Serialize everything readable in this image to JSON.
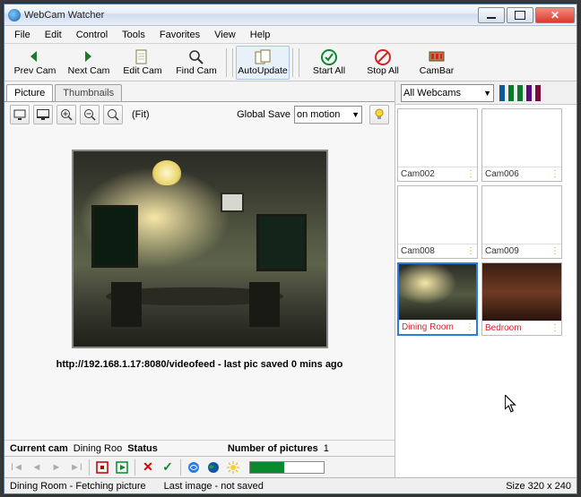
{
  "window": {
    "title": "WebCam Watcher"
  },
  "menubar": [
    "File",
    "Edit",
    "Control",
    "Tools",
    "Favorites",
    "View",
    "Help"
  ],
  "toolbar": [
    {
      "name": "prev-cam-button",
      "label": "Prev Cam",
      "icon": "arrow-left"
    },
    {
      "name": "next-cam-button",
      "label": "Next Cam",
      "icon": "arrow-right"
    },
    {
      "name": "edit-cam-button",
      "label": "Edit Cam",
      "icon": "doc"
    },
    {
      "name": "find-cam-button",
      "label": "Find Cam",
      "icon": "magnifier"
    },
    {
      "name": "auto-update-button",
      "label": "AutoUpdate",
      "icon": "two-docs",
      "active": true
    },
    {
      "name": "start-all-button",
      "label": "Start All",
      "icon": "check-green"
    },
    {
      "name": "stop-all-button",
      "label": "Stop All",
      "icon": "no-entry"
    },
    {
      "name": "cambar-button",
      "label": "CamBar",
      "icon": "bar"
    }
  ],
  "tabs": {
    "active": "Picture",
    "other": "Thumbnails"
  },
  "subbar": {
    "fit": "(Fit)",
    "global_save_label": "Global Save",
    "global_save_value": "on motion"
  },
  "image_status": {
    "url_line": "http://192.168.1.17:8080/videofeed - last pic saved 0 mins ago",
    "current_cam_label": "Current cam",
    "current_cam_value": "Dining Roo",
    "status_label": "Status",
    "num_pics_label": "Number of pictures",
    "num_pics_value": "1"
  },
  "right": {
    "filter_label": "All Webcams",
    "stripes": [
      "#105a9a",
      "#0a7a2a",
      "#0a7a2a",
      "#5a0a7a",
      "#7a0a3a"
    ],
    "cams": [
      {
        "name": "Cam002",
        "thumb": "blank",
        "red": false
      },
      {
        "name": "Cam006",
        "thumb": "blank",
        "red": false
      },
      {
        "name": "Cam008",
        "thumb": "blank",
        "red": false
      },
      {
        "name": "Cam009",
        "thumb": "blank",
        "red": false
      },
      {
        "name": "Dining Room",
        "thumb": "dining",
        "red": true,
        "selected": true
      },
      {
        "name": "Bedroom",
        "thumb": "dim",
        "red": true
      }
    ]
  },
  "statusbar": {
    "left": "Dining Room - Fetching picture",
    "mid": "Last image - not saved",
    "right": "Size 320 x 240"
  }
}
